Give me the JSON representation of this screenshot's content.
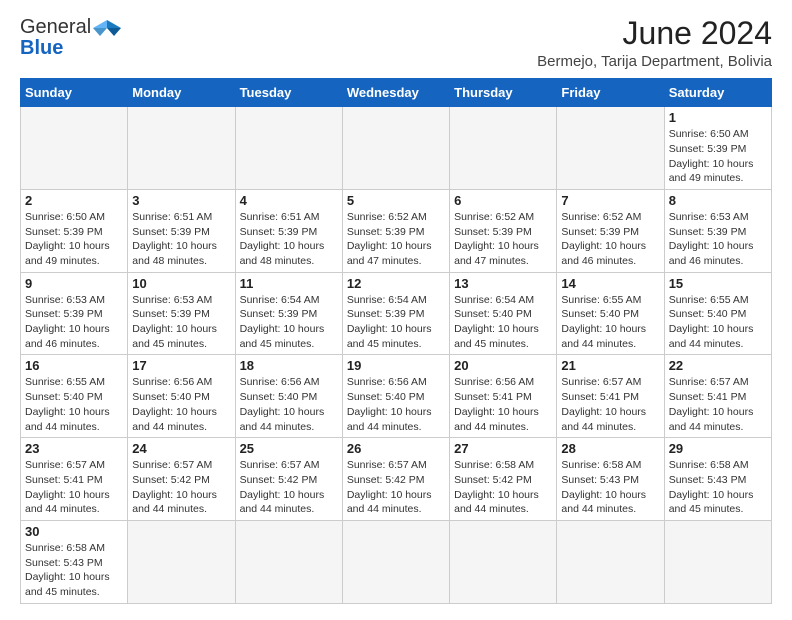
{
  "header": {
    "logo_line1": "General",
    "logo_line2": "Blue",
    "month_title": "June 2024",
    "location": "Bermejo, Tarija Department, Bolivia"
  },
  "weekdays": [
    "Sunday",
    "Monday",
    "Tuesday",
    "Wednesday",
    "Thursday",
    "Friday",
    "Saturday"
  ],
  "weeks": [
    [
      {
        "day": "",
        "info": "",
        "empty": true
      },
      {
        "day": "",
        "info": "",
        "empty": true
      },
      {
        "day": "",
        "info": "",
        "empty": true
      },
      {
        "day": "",
        "info": "",
        "empty": true
      },
      {
        "day": "",
        "info": "",
        "empty": true
      },
      {
        "day": "",
        "info": "",
        "empty": true
      },
      {
        "day": "1",
        "info": "Sunrise: 6:50 AM\nSunset: 5:39 PM\nDaylight: 10 hours\nand 49 minutes.",
        "empty": false
      }
    ],
    [
      {
        "day": "2",
        "info": "Sunrise: 6:50 AM\nSunset: 5:39 PM\nDaylight: 10 hours\nand 49 minutes.",
        "empty": false
      },
      {
        "day": "3",
        "info": "Sunrise: 6:51 AM\nSunset: 5:39 PM\nDaylight: 10 hours\nand 48 minutes.",
        "empty": false
      },
      {
        "day": "4",
        "info": "Sunrise: 6:51 AM\nSunset: 5:39 PM\nDaylight: 10 hours\nand 48 minutes.",
        "empty": false
      },
      {
        "day": "5",
        "info": "Sunrise: 6:52 AM\nSunset: 5:39 PM\nDaylight: 10 hours\nand 47 minutes.",
        "empty": false
      },
      {
        "day": "6",
        "info": "Sunrise: 6:52 AM\nSunset: 5:39 PM\nDaylight: 10 hours\nand 47 minutes.",
        "empty": false
      },
      {
        "day": "7",
        "info": "Sunrise: 6:52 AM\nSunset: 5:39 PM\nDaylight: 10 hours\nand 46 minutes.",
        "empty": false
      },
      {
        "day": "8",
        "info": "Sunrise: 6:53 AM\nSunset: 5:39 PM\nDaylight: 10 hours\nand 46 minutes.",
        "empty": false
      }
    ],
    [
      {
        "day": "9",
        "info": "Sunrise: 6:53 AM\nSunset: 5:39 PM\nDaylight: 10 hours\nand 46 minutes.",
        "empty": false
      },
      {
        "day": "10",
        "info": "Sunrise: 6:53 AM\nSunset: 5:39 PM\nDaylight: 10 hours\nand 45 minutes.",
        "empty": false
      },
      {
        "day": "11",
        "info": "Sunrise: 6:54 AM\nSunset: 5:39 PM\nDaylight: 10 hours\nand 45 minutes.",
        "empty": false
      },
      {
        "day": "12",
        "info": "Sunrise: 6:54 AM\nSunset: 5:39 PM\nDaylight: 10 hours\nand 45 minutes.",
        "empty": false
      },
      {
        "day": "13",
        "info": "Sunrise: 6:54 AM\nSunset: 5:40 PM\nDaylight: 10 hours\nand 45 minutes.",
        "empty": false
      },
      {
        "day": "14",
        "info": "Sunrise: 6:55 AM\nSunset: 5:40 PM\nDaylight: 10 hours\nand 44 minutes.",
        "empty": false
      },
      {
        "day": "15",
        "info": "Sunrise: 6:55 AM\nSunset: 5:40 PM\nDaylight: 10 hours\nand 44 minutes.",
        "empty": false
      }
    ],
    [
      {
        "day": "16",
        "info": "Sunrise: 6:55 AM\nSunset: 5:40 PM\nDaylight: 10 hours\nand 44 minutes.",
        "empty": false
      },
      {
        "day": "17",
        "info": "Sunrise: 6:56 AM\nSunset: 5:40 PM\nDaylight: 10 hours\nand 44 minutes.",
        "empty": false
      },
      {
        "day": "18",
        "info": "Sunrise: 6:56 AM\nSunset: 5:40 PM\nDaylight: 10 hours\nand 44 minutes.",
        "empty": false
      },
      {
        "day": "19",
        "info": "Sunrise: 6:56 AM\nSunset: 5:40 PM\nDaylight: 10 hours\nand 44 minutes.",
        "empty": false
      },
      {
        "day": "20",
        "info": "Sunrise: 6:56 AM\nSunset: 5:41 PM\nDaylight: 10 hours\nand 44 minutes.",
        "empty": false
      },
      {
        "day": "21",
        "info": "Sunrise: 6:57 AM\nSunset: 5:41 PM\nDaylight: 10 hours\nand 44 minutes.",
        "empty": false
      },
      {
        "day": "22",
        "info": "Sunrise: 6:57 AM\nSunset: 5:41 PM\nDaylight: 10 hours\nand 44 minutes.",
        "empty": false
      }
    ],
    [
      {
        "day": "23",
        "info": "Sunrise: 6:57 AM\nSunset: 5:41 PM\nDaylight: 10 hours\nand 44 minutes.",
        "empty": false
      },
      {
        "day": "24",
        "info": "Sunrise: 6:57 AM\nSunset: 5:42 PM\nDaylight: 10 hours\nand 44 minutes.",
        "empty": false
      },
      {
        "day": "25",
        "info": "Sunrise: 6:57 AM\nSunset: 5:42 PM\nDaylight: 10 hours\nand 44 minutes.",
        "empty": false
      },
      {
        "day": "26",
        "info": "Sunrise: 6:57 AM\nSunset: 5:42 PM\nDaylight: 10 hours\nand 44 minutes.",
        "empty": false
      },
      {
        "day": "27",
        "info": "Sunrise: 6:58 AM\nSunset: 5:42 PM\nDaylight: 10 hours\nand 44 minutes.",
        "empty": false
      },
      {
        "day": "28",
        "info": "Sunrise: 6:58 AM\nSunset: 5:43 PM\nDaylight: 10 hours\nand 44 minutes.",
        "empty": false
      },
      {
        "day": "29",
        "info": "Sunrise: 6:58 AM\nSunset: 5:43 PM\nDaylight: 10 hours\nand 45 minutes.",
        "empty": false
      }
    ],
    [
      {
        "day": "30",
        "info": "Sunrise: 6:58 AM\nSunset: 5:43 PM\nDaylight: 10 hours\nand 45 minutes.",
        "empty": false
      },
      {
        "day": "",
        "info": "",
        "empty": true
      },
      {
        "day": "",
        "info": "",
        "empty": true
      },
      {
        "day": "",
        "info": "",
        "empty": true
      },
      {
        "day": "",
        "info": "",
        "empty": true
      },
      {
        "day": "",
        "info": "",
        "empty": true
      },
      {
        "day": "",
        "info": "",
        "empty": true
      }
    ]
  ]
}
